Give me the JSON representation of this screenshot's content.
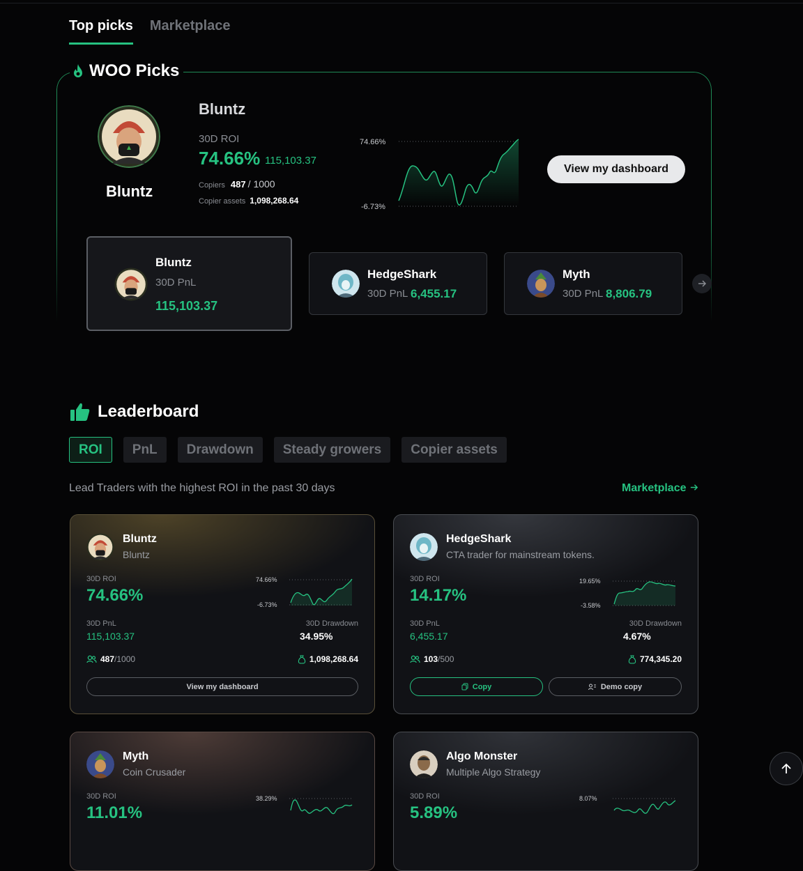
{
  "tabs": {
    "top_picks": "Top picks",
    "marketplace": "Marketplace"
  },
  "woo_picks": {
    "title": "WOO Picks",
    "featured": {
      "avatar_name": "Bluntz",
      "title": "Bluntz",
      "roi_label": "30D ROI",
      "roi": "74.66%",
      "pnl": "115,103.37",
      "copiers_label": "Copiers",
      "copiers": "487",
      "copiers_total": "/ 1000",
      "assets_label": "Copier assets",
      "assets": "1,098,268.64",
      "chart_max": "74.66%",
      "chart_min": "-6.73%",
      "button": "View my dashboard"
    },
    "carousel": [
      {
        "name": "Bluntz",
        "pnl_label": "30D PnL",
        "pnl": "115,103.37"
      },
      {
        "name": "HedgeShark",
        "pnl_label": "30D PnL",
        "pnl": "6,455.17"
      },
      {
        "name": "Myth",
        "pnl_label": "30D PnL",
        "pnl": "8,806.79"
      }
    ],
    "next_icon": "arrow-right-icon"
  },
  "leaderboard": {
    "title": "Leaderboard",
    "chips": [
      "ROI",
      "PnL",
      "Drawdown",
      "Steady growers",
      "Copier assets"
    ],
    "description": "Lead Traders with the highest ROI in the past 30 days",
    "marketplace_link": "Marketplace",
    "cards": [
      {
        "name": "Bluntz",
        "sub": "Bluntz",
        "roi_label": "30D ROI",
        "roi": "74.66%",
        "chart_max": "74.66%",
        "chart_min": "-6.73%",
        "pnl_label": "30D PnL",
        "pnl": "115,103.37",
        "dd_label": "30D Drawdown",
        "dd": "34.95%",
        "copiers": "487",
        "copiers_total": "/1000",
        "assets": "1,098,268.64",
        "button": "View my dashboard"
      },
      {
        "name": "HedgeShark",
        "sub": "CTA trader for mainstream tokens.",
        "roi_label": "30D ROI",
        "roi": "14.17%",
        "chart_max": "19.65%",
        "chart_min": "-3.58%",
        "pnl_label": "30D PnL",
        "pnl": "6,455.17",
        "dd_label": "30D Drawdown",
        "dd": "4.67%",
        "copiers": "103",
        "copiers_total": "/500",
        "assets": "774,345.20",
        "copy": "Copy",
        "demo_copy": "Demo copy"
      },
      {
        "name": "Myth",
        "sub": "Coin Crusader",
        "roi_label": "30D ROI",
        "roi": "11.01%",
        "chart_max": "38.29%"
      },
      {
        "name": "Algo Monster",
        "sub": "Multiple Algo Strategy",
        "roi_label": "30D ROI",
        "roi": "5.89%",
        "chart_max": "8.07%"
      }
    ]
  },
  "colors": {
    "accent": "#26c281",
    "bg": "#050506",
    "card": "#111216"
  }
}
